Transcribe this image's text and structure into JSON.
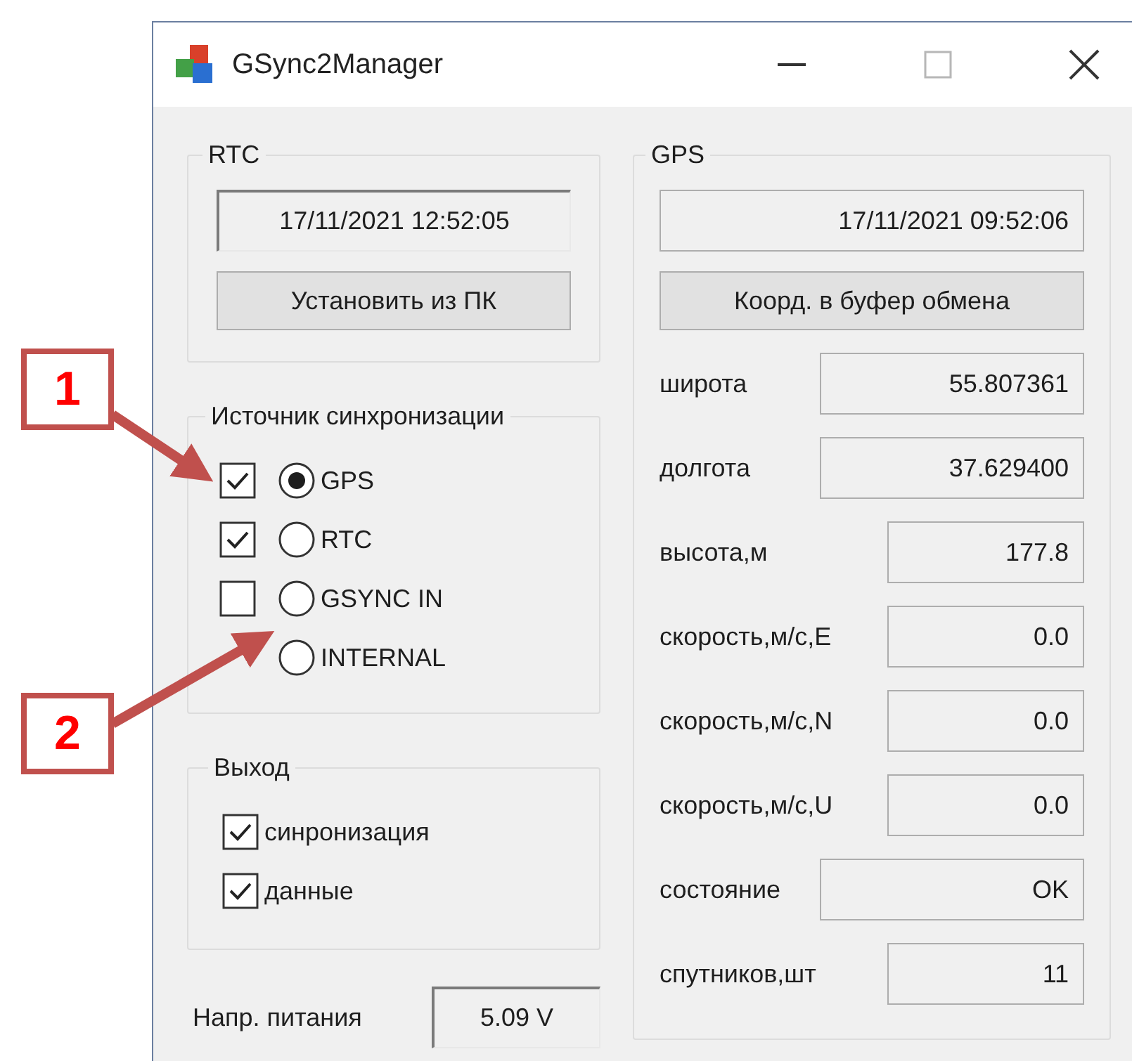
{
  "window": {
    "title": "GSync2Manager"
  },
  "rtc": {
    "title": "RTC",
    "datetime": "17/11/2021 12:52:05",
    "button": "Установить из ПК"
  },
  "sync_source": {
    "title": "Источник синхронизации",
    "items": [
      {
        "kind": "check-radio",
        "label": "GPS",
        "checked": true,
        "selected": true
      },
      {
        "kind": "check-radio",
        "label": "RTC",
        "checked": true,
        "selected": false
      },
      {
        "kind": "check-radio",
        "label": "GSYNC IN",
        "checked": false,
        "selected": false
      },
      {
        "kind": "radio",
        "label": "INTERNAL",
        "selected": false
      }
    ]
  },
  "output": {
    "title": "Выход",
    "items": [
      {
        "label": "синронизация",
        "checked": true
      },
      {
        "label": "данные",
        "checked": true
      }
    ]
  },
  "power": {
    "label": "Напр. питания",
    "value": "5.09 V"
  },
  "gps": {
    "title": "GPS",
    "datetime": "17/11/2021 09:52:06",
    "button": "Коорд. в буфер обмена",
    "fields": [
      {
        "label": "широта",
        "value": "55.807361"
      },
      {
        "label": "долгота",
        "value": "37.629400"
      },
      {
        "label": "высота,м",
        "value": "177.8"
      },
      {
        "label": "скорость,м/с,E",
        "value": "0.0"
      },
      {
        "label": "скорость,м/с,N",
        "value": "0.0"
      },
      {
        "label": "скорость,м/с,U",
        "value": "0.0"
      },
      {
        "label": "состояние",
        "value": "OK"
      },
      {
        "label": "спутников,шт",
        "value": "11"
      }
    ]
  },
  "annotations": [
    {
      "label": "1"
    },
    {
      "label": "2"
    }
  ]
}
